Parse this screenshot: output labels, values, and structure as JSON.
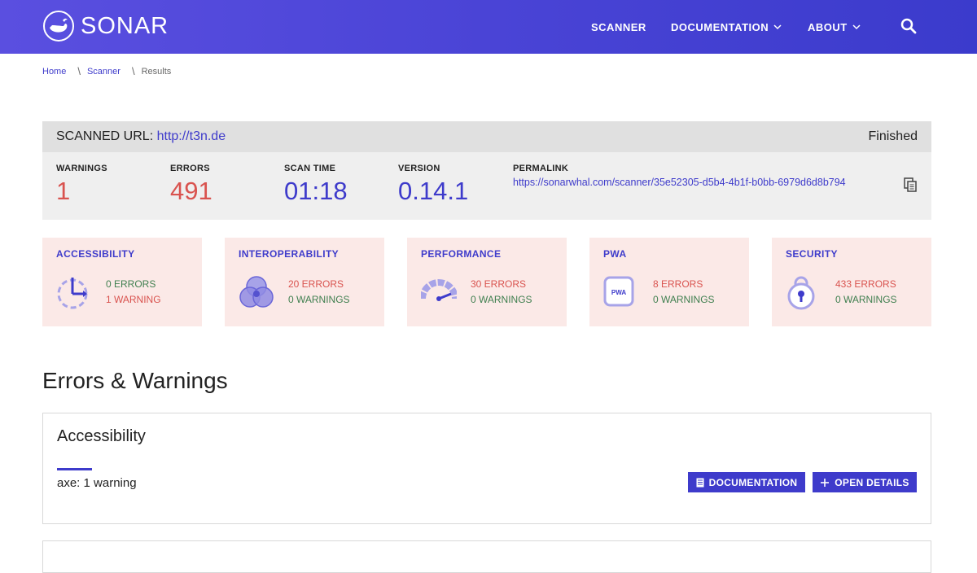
{
  "header": {
    "logo_text": "SONAR",
    "nav": [
      {
        "label": "SCANNER",
        "has_dropdown": false
      },
      {
        "label": "DOCUMENTATION",
        "has_dropdown": true
      },
      {
        "label": "ABOUT",
        "has_dropdown": true
      }
    ],
    "search_icon": "search-icon"
  },
  "breadcrumb": {
    "home": "Home",
    "scanner": "Scanner",
    "current": "Results",
    "separator": "\\"
  },
  "scan": {
    "url_label": "SCANNED URL:",
    "url": "http://t3n.de",
    "status": "Finished",
    "stats": [
      {
        "label": "WARNINGS",
        "value": "1"
      },
      {
        "label": "ERRORS",
        "value": "491"
      },
      {
        "label": "SCAN TIME",
        "value": "01:18"
      },
      {
        "label": "VERSION",
        "value": "0.14.1"
      }
    ],
    "permalink_label": "PERMALINK",
    "permalink": "https://sonarwhal.com/scanner/35e52305-d5b4-4b1f-b0bb-6979d6d8b794"
  },
  "categories": [
    {
      "title": "ACCESSIBILITY",
      "errors": "0 ERRORS",
      "warnings": "1 WARNING",
      "icon": "accessibility-icon"
    },
    {
      "title": "INTEROPERABILITY",
      "errors": "20 ERRORS",
      "warnings": "0 WARNINGS",
      "icon": "interoperability-icon"
    },
    {
      "title": "PERFORMANCE",
      "errors": "30 ERRORS",
      "warnings": "0 WARNINGS",
      "icon": "performance-gauge-icon"
    },
    {
      "title": "PWA",
      "errors": "8 ERRORS",
      "warnings": "0 WARNINGS",
      "icon": "pwa-icon",
      "icon_text": "PWA"
    },
    {
      "title": "SECURITY",
      "errors": "433 ERRORS",
      "warnings": "0 WARNINGS",
      "icon": "padlock-icon"
    }
  ],
  "errors_section": {
    "title": "Errors & Warnings",
    "panels": [
      {
        "title": "Accessibility",
        "rule": "axe: 1 warning",
        "doc_button": "DOCUMENTATION",
        "details_button": "OPEN DETAILS"
      }
    ]
  },
  "colors": {
    "brand": "#3e3bcb",
    "header_gradient_start": "#5a4fe0",
    "header_gradient_end": "#3b3bcc",
    "error_red": "#d9534f",
    "ok_green": "#3f7f4f",
    "card_bg": "#fbe9e7",
    "icon_lavender": "#a7a3e8"
  }
}
